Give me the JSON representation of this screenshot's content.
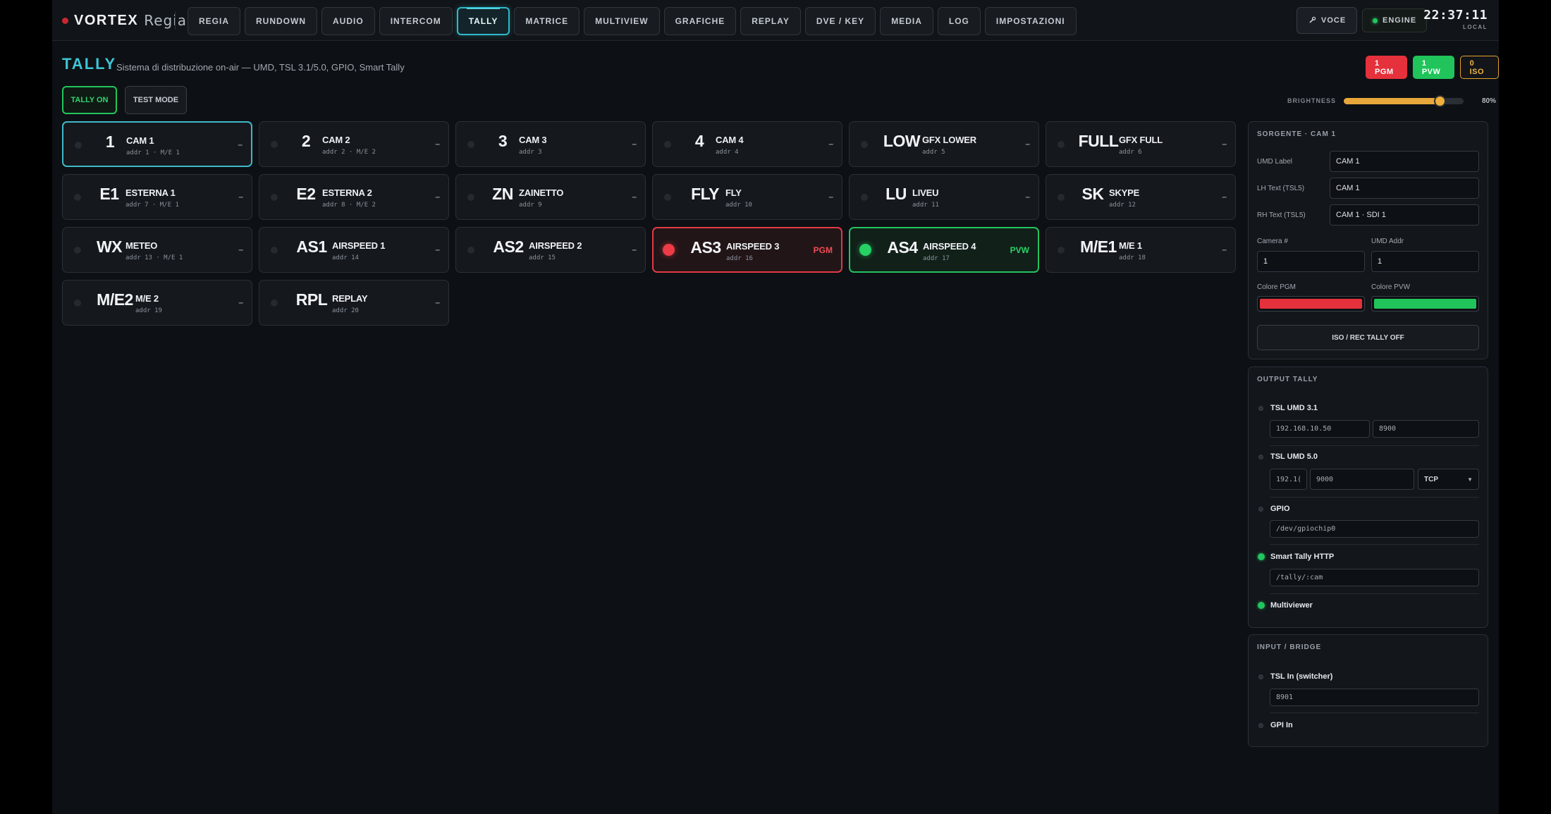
{
  "app": {
    "brand": "VORTEX",
    "product": "Regia"
  },
  "nav": [
    "REGIA",
    "RUNDOWN",
    "AUDIO",
    "INTERCOM",
    "TALLY",
    "MATRICE",
    "MULTIVIEW",
    "GRAFICHE",
    "REPLAY",
    "DVE / KEY",
    "MEDIA",
    "LOG",
    "IMPOSTAZIONI"
  ],
  "nav_active": "TALLY",
  "topbar": {
    "voice_label": "VOCE",
    "engine_label": "ENGINE",
    "clock_time": "22:37:11",
    "clock_zone": "LOCAL"
  },
  "header": {
    "title": "TALLY",
    "subtitle": "Sistema di distribuzione on-air — UMD, TSL 3.1/5.0, GPIO, Smart Tally"
  },
  "counts": {
    "pgm": "1 PGM",
    "pvw": "1 PVW",
    "iso": "0 ISO"
  },
  "controls": {
    "tally_on": "TALLY ON",
    "test_mode": "TEST MODE",
    "brightness_label": "BRIGHTNESS",
    "brightness_value": "80%",
    "brightness_level": 0.8
  },
  "colors": {
    "accent": "#3fc4d4",
    "pgm": "#e5313c",
    "pvw": "#20c45a",
    "iso": "#e5a22e"
  },
  "tiles": [
    {
      "num": "1",
      "name": "CAM 1",
      "addr": "addr 1 · M/E 1",
      "state": "–",
      "status": "selected"
    },
    {
      "num": "2",
      "name": "CAM 2",
      "addr": "addr 2 · M/E 2",
      "state": "–",
      "status": ""
    },
    {
      "num": "3",
      "name": "CAM 3",
      "addr": "addr 3",
      "state": "–",
      "status": ""
    },
    {
      "num": "4",
      "name": "CAM 4",
      "addr": "addr 4",
      "state": "–",
      "status": ""
    },
    {
      "num": "LOW",
      "name": "GFX LOWER",
      "addr": "addr 5",
      "state": "–",
      "status": ""
    },
    {
      "num": "FULL",
      "name": "GFX FULL",
      "addr": "addr 6",
      "state": "–",
      "status": ""
    },
    {
      "num": "E1",
      "name": "ESTERNA 1",
      "addr": "addr 7 · M/E 1",
      "state": "–",
      "status": ""
    },
    {
      "num": "E2",
      "name": "ESTERNA 2",
      "addr": "addr 8 · M/E 2",
      "state": "–",
      "status": ""
    },
    {
      "num": "ZN",
      "name": "ZAINETTO",
      "addr": "addr 9",
      "state": "–",
      "status": ""
    },
    {
      "num": "FLY",
      "name": "FLY",
      "addr": "addr 10",
      "state": "–",
      "status": ""
    },
    {
      "num": "LU",
      "name": "LIVEU",
      "addr": "addr 11",
      "state": "–",
      "status": ""
    },
    {
      "num": "SK",
      "name": "SKYPE",
      "addr": "addr 12",
      "state": "–",
      "status": ""
    },
    {
      "num": "WX",
      "name": "METEO",
      "addr": "addr 13 · M/E 1",
      "state": "–",
      "status": ""
    },
    {
      "num": "AS1",
      "name": "AIRSPEED 1",
      "addr": "addr 14",
      "state": "–",
      "status": ""
    },
    {
      "num": "AS2",
      "name": "AIRSPEED 2",
      "addr": "addr 15",
      "state": "–",
      "status": ""
    },
    {
      "num": "AS3",
      "name": "AIRSPEED 3",
      "addr": "addr 16",
      "state": "PGM",
      "status": "pgm"
    },
    {
      "num": "AS4",
      "name": "AIRSPEED 4",
      "addr": "addr 17",
      "state": "PVW",
      "status": "pvw"
    },
    {
      "num": "M/E1",
      "name": "M/E 1",
      "addr": "addr 18",
      "state": "–",
      "status": ""
    },
    {
      "num": "M/E2",
      "name": "M/E 2",
      "addr": "addr 19",
      "state": "–",
      "status": ""
    },
    {
      "num": "RPL",
      "name": "REPLAY",
      "addr": "addr 20",
      "state": "–",
      "status": ""
    }
  ],
  "source_panel": {
    "title": "SORGENTE · CAM 1",
    "umd_label_label": "UMD Label",
    "umd_label_value": "CAM 1",
    "lh_label": "LH Text (TSL5)",
    "lh_value": "CAM 1",
    "rh_label": "RH Text (TSL5)",
    "rh_value": "CAM 1 · SDI 1",
    "camera_label": "Camera #",
    "camera_value": "1",
    "umd_addr_label": "UMD Addr",
    "umd_addr_value": "1",
    "pgm_color_label": "Colore PGM",
    "pgm_color": "#e5313c",
    "pvw_color_label": "Colore PVW",
    "pvw_color": "#20c45a",
    "iso_button": "ISO / REC TALLY OFF"
  },
  "output_panel": {
    "title": "OUTPUT TALLY",
    "tsl31": {
      "label": "TSL UMD 3.1",
      "ip": "192.168.10.50",
      "port": "8900"
    },
    "tsl50": {
      "label": "TSL UMD 5.0",
      "ip": "192.1(",
      "port": "9000",
      "proto": "TCP"
    },
    "gpio": {
      "label": "GPIO",
      "path": "/dev/gpiochip0"
    },
    "smart": {
      "label": "Smart Tally HTTP",
      "path": "/tally/:cam"
    },
    "multiviewer": {
      "label": "Multiviewer"
    }
  },
  "input_panel": {
    "title": "INPUT / BRIDGE",
    "tsl_in": {
      "label": "TSL In (switcher)",
      "port": "8901"
    },
    "gpi_in": {
      "label": "GPI In"
    }
  }
}
